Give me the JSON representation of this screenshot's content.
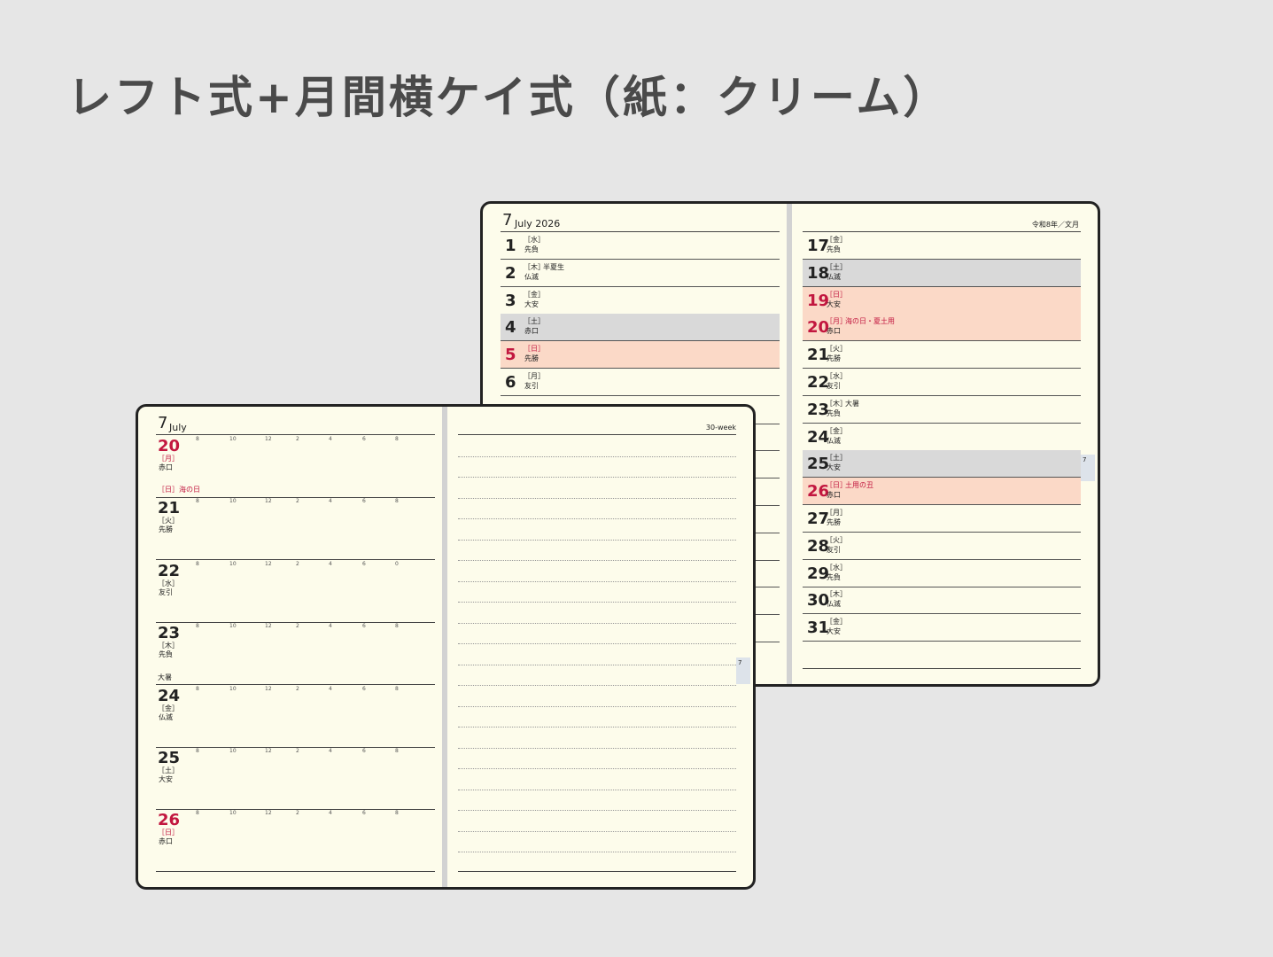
{
  "title": "レフト式+月間横ケイ式（紙：クリーム）",
  "colors": {
    "background": "#e6e6e6",
    "paper": "#fdfceb",
    "sunday_red": "#c2173f",
    "sunday_row": "#fbd9c7",
    "saturday_row": "#d9d9d9"
  },
  "monthly": {
    "month_num": "7",
    "month_title": "July 2026",
    "era": "令和8年／文月",
    "tab": "7",
    "left_days": [
      {
        "n": "1",
        "wd": "［水］",
        "rk": "先負",
        "ev": "",
        "type": "weekday"
      },
      {
        "n": "2",
        "wd": "［木］",
        "rk": "仏滅",
        "ev": "半夏生",
        "type": "weekday"
      },
      {
        "n": "3",
        "wd": "［金］",
        "rk": "大安",
        "ev": "",
        "type": "weekday"
      },
      {
        "n": "4",
        "wd": "［土］",
        "rk": "赤口",
        "ev": "",
        "type": "sat"
      },
      {
        "n": "5",
        "wd": "［日］",
        "rk": "先勝",
        "ev": "",
        "type": "sun"
      },
      {
        "n": "6",
        "wd": "［月］",
        "rk": "友引",
        "ev": "",
        "type": "weekday"
      }
    ],
    "right_days": [
      {
        "n": "17",
        "wd": "［金］",
        "rk": "先負",
        "ev": "",
        "type": "weekday"
      },
      {
        "n": "18",
        "wd": "［土］",
        "rk": "仏滅",
        "ev": "",
        "type": "sat"
      },
      {
        "n": "19",
        "wd": "［日］",
        "rk": "大安",
        "ev": "",
        "type": "sun"
      },
      {
        "n": "20",
        "wd": "［月］",
        "rk": "赤口",
        "ev": "海の日・夏土用",
        "type": "sun"
      },
      {
        "n": "21",
        "wd": "［火］",
        "rk": "先勝",
        "ev": "",
        "type": "weekday"
      },
      {
        "n": "22",
        "wd": "［水］",
        "rk": "友引",
        "ev": "",
        "type": "weekday"
      },
      {
        "n": "23",
        "wd": "［木］",
        "rk": "先負",
        "ev": "大暑",
        "type": "weekday"
      },
      {
        "n": "24",
        "wd": "［金］",
        "rk": "仏滅",
        "ev": "",
        "type": "weekday"
      },
      {
        "n": "25",
        "wd": "［土］",
        "rk": "大安",
        "ev": "",
        "type": "sat"
      },
      {
        "n": "26",
        "wd": "［日］",
        "rk": "赤口",
        "ev": "土用の丑",
        "type": "sun"
      },
      {
        "n": "27",
        "wd": "［月］",
        "rk": "先勝",
        "ev": "",
        "type": "weekday"
      },
      {
        "n": "28",
        "wd": "［火］",
        "rk": "友引",
        "ev": "",
        "type": "weekday"
      },
      {
        "n": "29",
        "wd": "［水］",
        "rk": "先負",
        "ev": "",
        "type": "weekday"
      },
      {
        "n": "30",
        "wd": "［木］",
        "rk": "仏滅",
        "ev": "",
        "type": "weekday"
      },
      {
        "n": "31",
        "wd": "［金］",
        "rk": "大安",
        "ev": "",
        "type": "weekday"
      }
    ]
  },
  "weekly": {
    "month_num": "7",
    "month_name": "July",
    "week_label": "30-week",
    "tab": "7",
    "hours": [
      "8",
      "10",
      "12",
      "2",
      "4",
      "6",
      "8"
    ],
    "hours_alt": [
      "8",
      "10",
      "12",
      "2",
      "4",
      "6",
      "0"
    ],
    "days": [
      {
        "n": "20",
        "wd": "［月］",
        "rk": "赤口",
        "pre": "",
        "type": "sun"
      },
      {
        "n": "21",
        "wd": "［火］",
        "rk": "先勝",
        "pre": "［日］海の日",
        "type": "weekday"
      },
      {
        "n": "22",
        "wd": "［水］",
        "rk": "友引",
        "pre": "",
        "type": "weekday"
      },
      {
        "n": "23",
        "wd": "［木］",
        "rk": "先負",
        "pre": "",
        "type": "weekday"
      },
      {
        "n": "24",
        "wd": "［金］",
        "rk": "仏滅",
        "pre": "大暑",
        "type": "weekday"
      },
      {
        "n": "25",
        "wd": "［土］",
        "rk": "大安",
        "pre": "",
        "type": "weekday"
      },
      {
        "n": "26",
        "wd": "［日］",
        "rk": "赤口",
        "pre": "",
        "type": "sun"
      }
    ]
  }
}
